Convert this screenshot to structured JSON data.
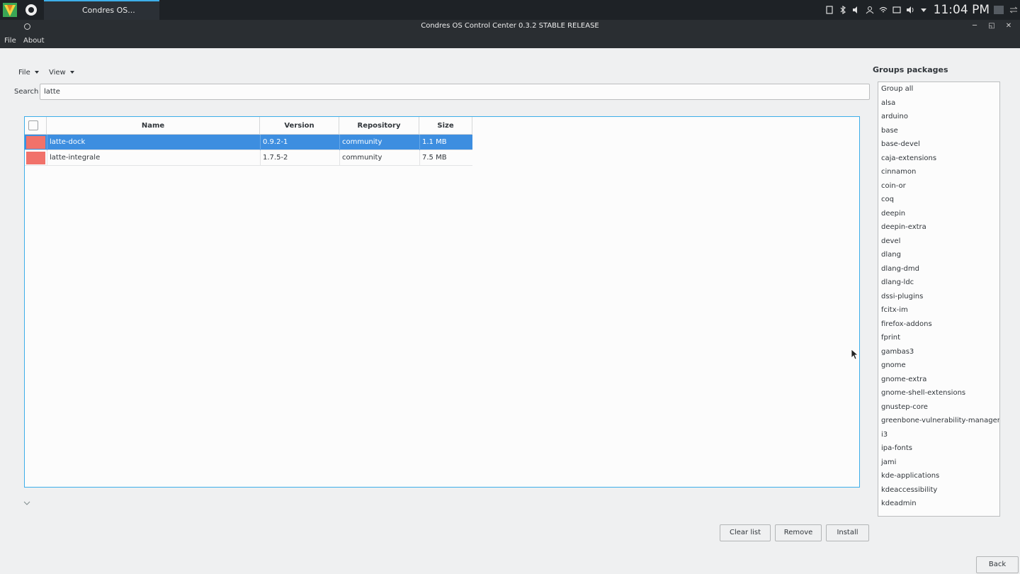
{
  "taskbar": {
    "task_label": "Condres OS...",
    "clock": "11:04 PM"
  },
  "window": {
    "title": "Condres OS Control Center 0.3.2 STABLE RELEASE"
  },
  "menubar": {
    "file": "File",
    "about": "About"
  },
  "toolbar": {
    "file_menu": "File",
    "view_menu": "View"
  },
  "search": {
    "label": "Search",
    "value": "latte"
  },
  "table": {
    "columns": [
      "Name",
      "Version",
      "Repository",
      "Size"
    ],
    "rows": [
      {
        "name": "latte-dock",
        "version": "0.9.2-1",
        "repository": "community",
        "size": "1.1 MB"
      },
      {
        "name": "latte-integrale",
        "version": "1.7.5-2",
        "repository": "community",
        "size": "7.5 MB"
      }
    ]
  },
  "groups": {
    "title": "Groups packages",
    "items": [
      "Group all",
      "alsa",
      "arduino",
      "base",
      "base-devel",
      "caja-extensions",
      "cinnamon",
      "coin-or",
      "coq",
      "deepin",
      "deepin-extra",
      "devel",
      "dlang",
      "dlang-dmd",
      "dlang-ldc",
      "dssi-plugins",
      "fcitx-im",
      "firefox-addons",
      "fprint",
      "gambas3",
      "gnome",
      "gnome-extra",
      "gnome-shell-extensions",
      "gnustep-core",
      "greenbone-vulnerability-manager",
      "i3",
      "ipa-fonts",
      "jami",
      "kde-applications",
      "kdeaccessibility",
      "kdeadmin"
    ]
  },
  "buttons": {
    "clear_list": "Clear list",
    "remove": "Remove",
    "install": "Install",
    "back": "Back"
  },
  "colors": {
    "accent": "#3daee9",
    "selection": "#3d8ee0",
    "swatch": "#f1726a",
    "chrome": "#2a2e32"
  }
}
